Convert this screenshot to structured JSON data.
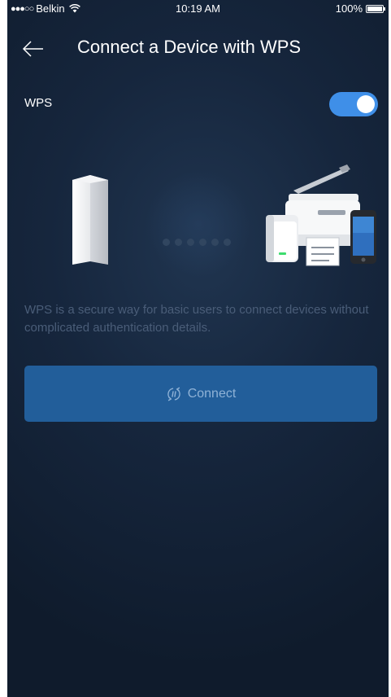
{
  "status_bar": {
    "signal": "●●●○○",
    "carrier": "Belkin",
    "time": "10:19 AM",
    "battery": "100%"
  },
  "header": {
    "title": "Connect a Device with WPS",
    "back_icon": "arrow-left-icon"
  },
  "wps": {
    "label": "WPS",
    "enabled": true
  },
  "illustration": {
    "router": "node-router-illustration",
    "devices": "printer-extender-phone-illustration",
    "dot_count": 6
  },
  "description": "WPS is a secure way for basic users to connect devices without complicated authentication details.",
  "connect_button": {
    "label": "Connect",
    "icon": "wps-icon"
  },
  "colors": {
    "background": "#13233a",
    "toggle_on": "#3f8fe8",
    "button": "#225e9a",
    "button_text": "#8fb2d6",
    "description_text": "#4a5d78"
  }
}
